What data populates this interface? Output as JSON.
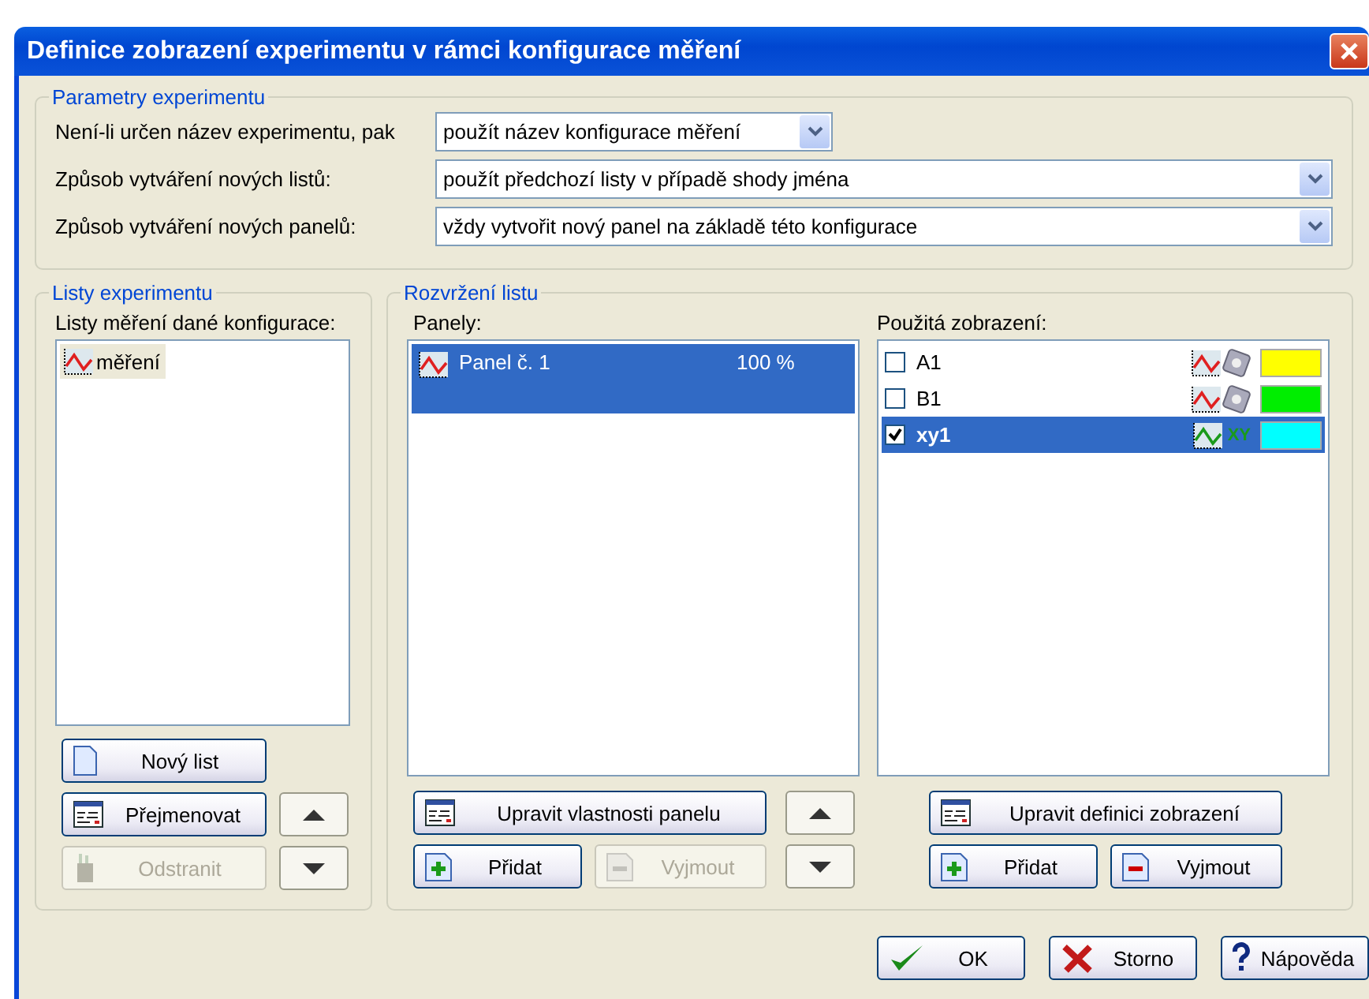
{
  "window": {
    "title": "Definice zobrazení experimentu v rámci konfigurace měření"
  },
  "parameters": {
    "title": "Parametry experimentu",
    "rows": [
      {
        "label": "Není-li určen název experimentu, pak",
        "value": "použít název konfigurace měření",
        "kind": "short"
      },
      {
        "label": "Způsob vytváření nových listů:",
        "value": "použít předchozí listy v případě shody jména",
        "kind": "wide"
      },
      {
        "label": "Způsob vytváření nových panelů:",
        "value": "vždy vytvořit nový panel na základě této konfigurace",
        "kind": "wide"
      }
    ]
  },
  "sheets": {
    "title": "Listy experimentu",
    "list_label": "Listy měření dané konfigurace:",
    "items": [
      {
        "label": "měření",
        "selected": true
      }
    ],
    "buttons": [
      {
        "label": "Nový list",
        "kind": "page",
        "disabled": false
      },
      {
        "label": "Přejmenovat",
        "kind": "form",
        "disabled": false
      },
      {
        "label": "Odstranit",
        "kind": "bin",
        "disabled": true
      }
    ]
  },
  "layout": {
    "title": "Rozvržení listu",
    "panels_label": "Panely:",
    "panels": [
      {
        "name": "Panel č. 1",
        "percent": "100 %",
        "selected": true
      }
    ],
    "panel_buttons": [
      {
        "label": "Upravit vlastnosti panelu",
        "kind": "form",
        "disabled": false
      },
      {
        "label": "Přidat",
        "kind": "add",
        "disabled": false
      },
      {
        "label": "Vyjmout",
        "kind": "remove",
        "disabled": true
      }
    ],
    "views_label": "Použitá zobrazení:",
    "views": [
      {
        "name": "A1",
        "checked": false,
        "selected": false,
        "kind": "graph",
        "color": "#ffff00"
      },
      {
        "name": "B1",
        "checked": false,
        "selected": false,
        "kind": "graph",
        "color": "#00ee00"
      },
      {
        "name": "xy1",
        "checked": true,
        "selected": true,
        "kind": "xy",
        "icon_text": "XY",
        "color": "#00ffff"
      }
    ],
    "view_buttons": [
      {
        "label": "Upravit definici zobrazení",
        "kind": "form",
        "disabled": false
      },
      {
        "label": "Přidat",
        "kind": "add",
        "disabled": false
      },
      {
        "label": "Vyjmout",
        "kind": "remove",
        "disabled": false
      }
    ]
  },
  "footer": [
    {
      "label": "OK",
      "kind": "ok"
    },
    {
      "label": "Storno",
      "kind": "cancel"
    },
    {
      "label": "Nápověda",
      "kind": "help"
    }
  ]
}
